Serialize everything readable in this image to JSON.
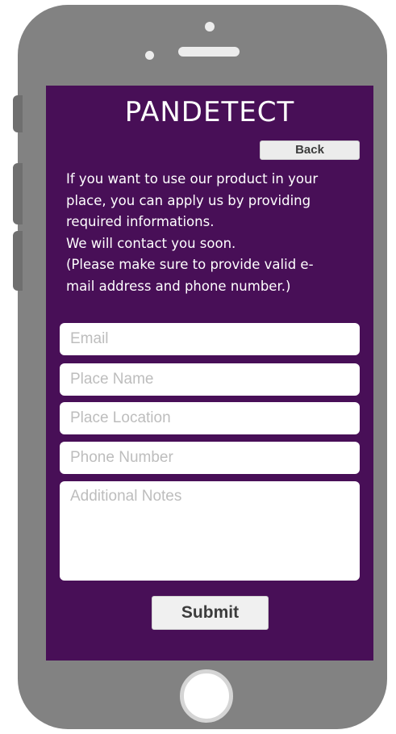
{
  "app": {
    "title": "PANDETECT",
    "back_label": "Back"
  },
  "intro": {
    "lines": [
      "If you want to use our product in your",
      "place, you can apply us by providing",
      "required informations.",
      "We will contact you soon.",
      "(Please make sure to provide valid e-",
      "mail address and phone number.)"
    ]
  },
  "form": {
    "email_placeholder": "Email",
    "place_name_placeholder": "Place Name",
    "place_location_placeholder": "Place Location",
    "phone_placeholder": "Phone Number",
    "notes_placeholder": "Additional Notes",
    "submit_label": "Submit"
  },
  "colors": {
    "screen_bg": "#480f57",
    "phone_body": "#828282",
    "text_light": "#ffffff",
    "placeholder": "#bdbdbd"
  },
  "icons": [
    "camera-icon",
    "proximity-sensor-icon",
    "speaker-icon",
    "home-button-icon"
  ]
}
